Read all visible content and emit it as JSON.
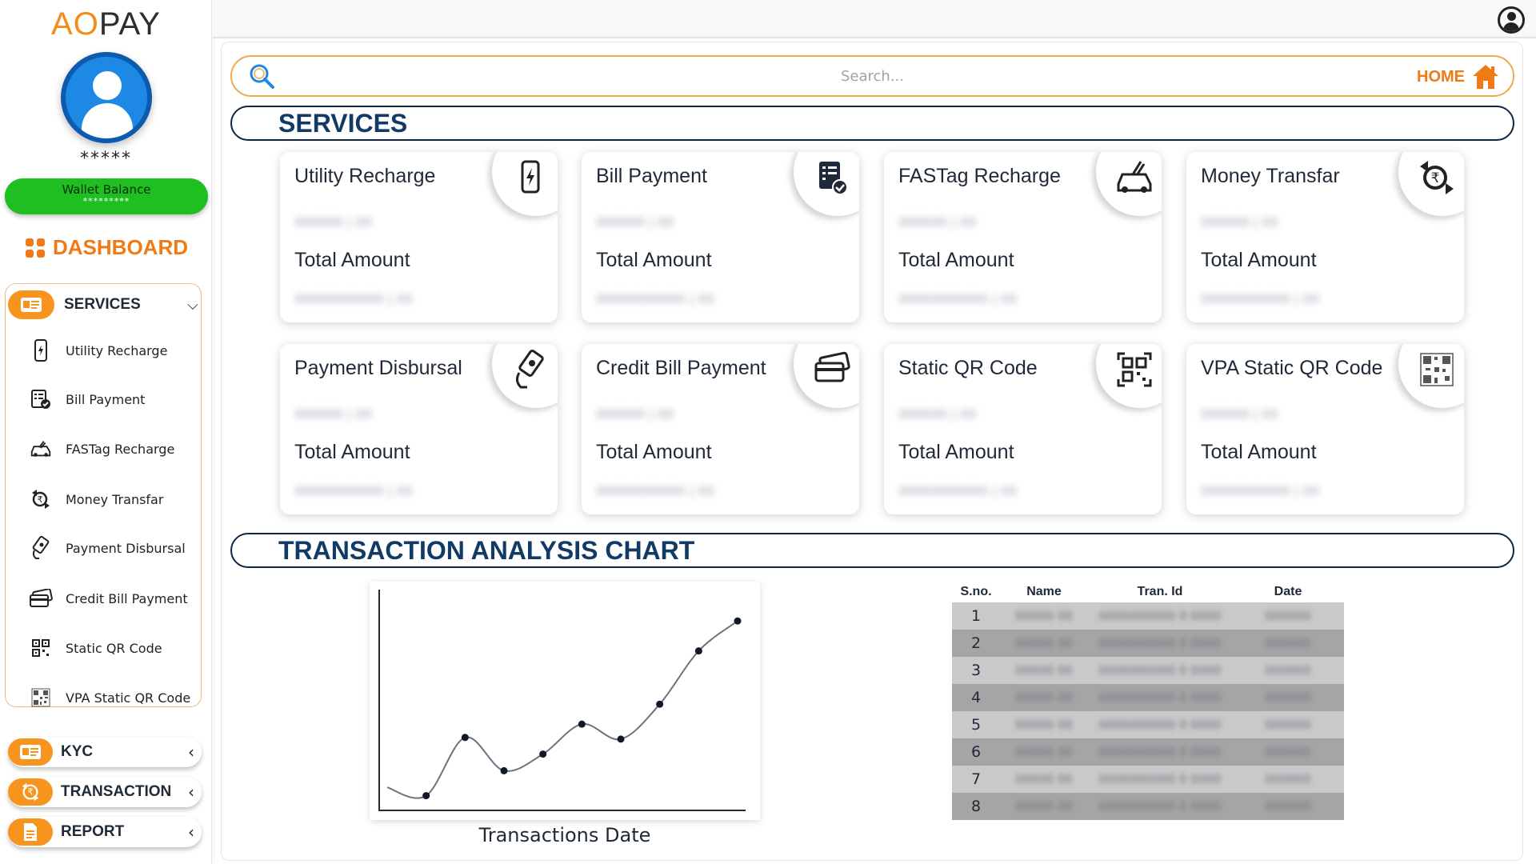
{
  "brand": {
    "logo_a": "A",
    "logo_o": "O",
    "logo_rest": "PAY"
  },
  "user": {
    "masked_name": "*****"
  },
  "wallet": {
    "label": "Wallet Balance",
    "value": "*********"
  },
  "sidebar": {
    "dashboard": "DASHBOARD",
    "services": {
      "label": "SERVICES",
      "items": [
        {
          "label": "Utility Recharge",
          "icon": "mobile-recharge-icon"
        },
        {
          "label": "Bill Payment",
          "icon": "bill-icon"
        },
        {
          "label": "FASTag Recharge",
          "icon": "car-icon"
        },
        {
          "label": "Money Transfar",
          "icon": "rupee-transfer-icon"
        },
        {
          "label": "Payment Disbursal",
          "icon": "hand-money-icon"
        },
        {
          "label": "Credit Bill Payment",
          "icon": "credit-card-icon"
        },
        {
          "label": "Static QR Code",
          "icon": "qr-scan-icon"
        },
        {
          "label": "VPA Static QR Code",
          "icon": "qr-code-icon"
        }
      ]
    },
    "kyc": "KYC",
    "transaction": "TRANSACTION",
    "report": "REPORT"
  },
  "search": {
    "placeholder": "Search...",
    "home": "HOME"
  },
  "services_title": "SERVICES",
  "cards": [
    {
      "title": "Utility Recharge",
      "total_label": "Total Amount",
      "count": "000000 | 00",
      "amount": "00000000000 | 00"
    },
    {
      "title": "Bill Payment",
      "total_label": "Total Amount",
      "count": "000000 | 00",
      "amount": "00000000000 | 00"
    },
    {
      "title": "FASTag Recharge",
      "total_label": "Total Amount",
      "count": "000000 | 00",
      "amount": "00000000000 | 00"
    },
    {
      "title": "Money Transfar",
      "total_label": "Total Amount",
      "count": "000000 | 00",
      "amount": "00000000000 | 00"
    },
    {
      "title": "Payment Disbursal",
      "total_label": "Total Amount",
      "count": "000000 | 00",
      "amount": "00000000000 | 00"
    },
    {
      "title": "Credit Bill Payment",
      "total_label": "Total Amount",
      "count": "000000 | 00",
      "amount": "00000000000 | 00"
    },
    {
      "title": "Static QR Code",
      "total_label": "Total Amount",
      "count": "000000 | 00",
      "amount": "00000000000 | 00"
    },
    {
      "title": "VPA Static QR Code",
      "total_label": "Total Amount",
      "count": "000000 | 00",
      "amount": "00000000000 | 00"
    }
  ],
  "analysis_title": "TRANSACTION ANALYSIS CHART",
  "chart_data": {
    "type": "line",
    "xlabel": "Transactions Date",
    "ylabel": "",
    "x": [
      1,
      2,
      3,
      4,
      5,
      6,
      7,
      8,
      9,
      10
    ],
    "series": [
      {
        "values": [
          2,
          1,
          8,
          4,
          6,
          9.6,
          7.8,
          12,
          18.4,
          22
        ]
      }
    ],
    "ylim": [
      0,
      25
    ],
    "grid": false
  },
  "table": {
    "headers": [
      "S.no.",
      "Name",
      "Tran. Id",
      "Date"
    ],
    "rows": [
      [
        "1",
        "00000 00",
        "0000000000 0 0000",
        "000000"
      ],
      [
        "2",
        "00000 00",
        "0000000000 0 0000",
        "000000"
      ],
      [
        "3",
        "00000 00",
        "0000000000 0 0000",
        "000000"
      ],
      [
        "4",
        "00000 00",
        "0000000000 0 0000",
        "000000"
      ],
      [
        "5",
        "00000 00",
        "0000000000 0 0000",
        "000000"
      ],
      [
        "6",
        "00000 00",
        "0000000000 0 0000",
        "000000"
      ],
      [
        "7",
        "00000 00",
        "0000000000 0 0000",
        "000000"
      ],
      [
        "8",
        "00000 00",
        "0000000000 0 0000",
        "000000"
      ]
    ]
  },
  "colors": {
    "accent": "#f7941d",
    "navy": "#123a66",
    "wallet": "#1fbf22",
    "avatar": "#1e88e5"
  }
}
